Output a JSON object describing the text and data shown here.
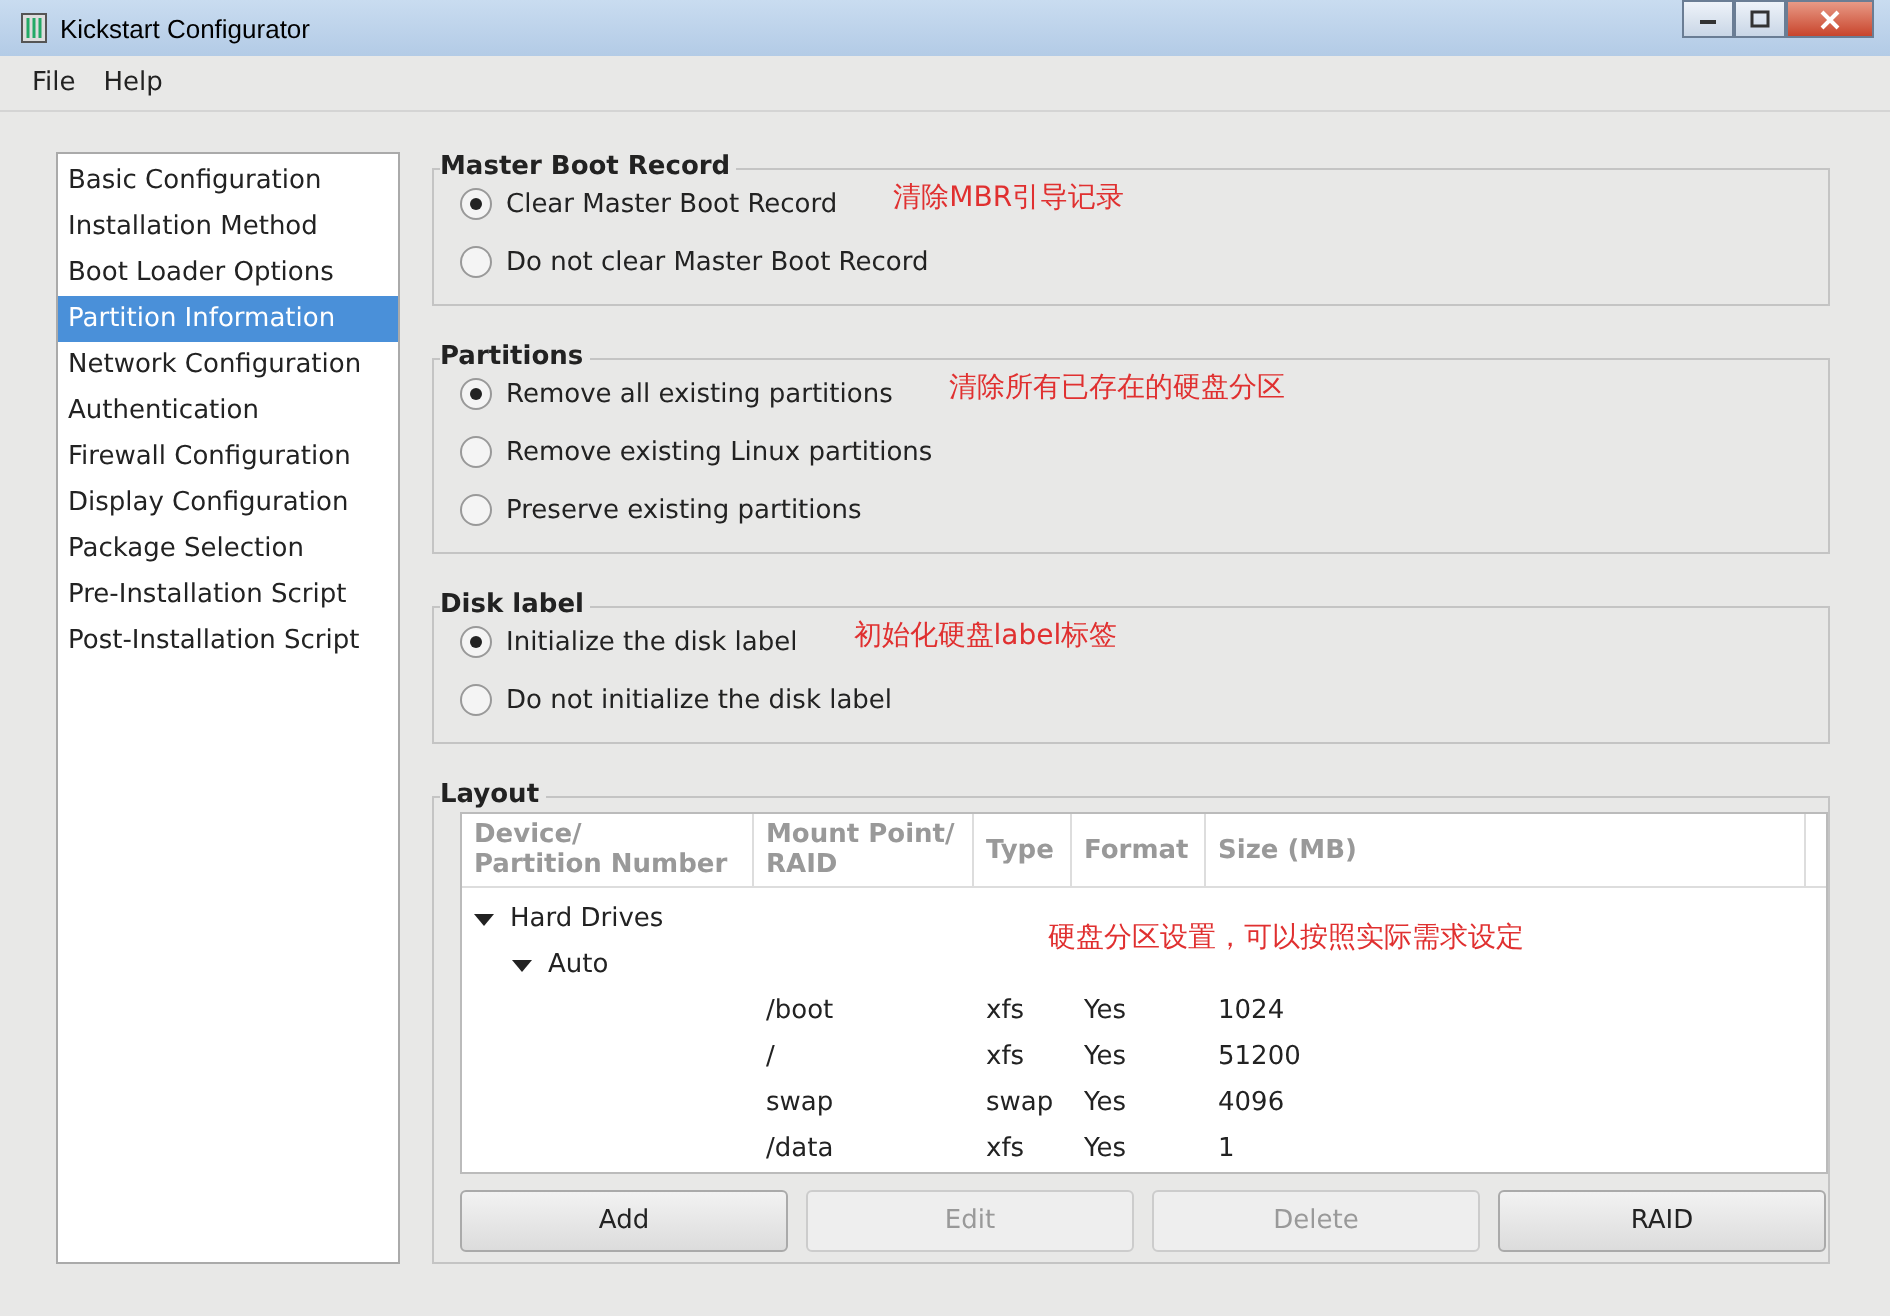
{
  "window": {
    "title": "Kickstart Configurator"
  },
  "menu": [
    {
      "label": "File"
    },
    {
      "label": "Help"
    }
  ],
  "sidebar": {
    "items": [
      {
        "label": "Basic Configuration",
        "selected": false
      },
      {
        "label": "Installation Method",
        "selected": false
      },
      {
        "label": "Boot Loader Options",
        "selected": false
      },
      {
        "label": "Partition Information",
        "selected": true
      },
      {
        "label": "Network Configuration",
        "selected": false
      },
      {
        "label": "Authentication",
        "selected": false
      },
      {
        "label": "Firewall Configuration",
        "selected": false
      },
      {
        "label": "Display Configuration",
        "selected": false
      },
      {
        "label": "Package Selection",
        "selected": false
      },
      {
        "label": "Pre-Installation Script",
        "selected": false
      },
      {
        "label": "Post-Installation Script",
        "selected": false
      }
    ]
  },
  "groups": [
    {
      "title": "Master Boot Record",
      "note": "清除MBR引导记录",
      "options": [
        {
          "label": "Clear Master Boot Record",
          "selected": true
        },
        {
          "label": "Do not clear Master Boot Record",
          "selected": false
        }
      ]
    },
    {
      "title": "Partitions",
      "note": "清除所有已存在的硬盘分区",
      "options": [
        {
          "label": "Remove all existing partitions",
          "selected": true
        },
        {
          "label": "Remove existing Linux partitions",
          "selected": false
        },
        {
          "label": "Preserve existing partitions",
          "selected": false
        }
      ]
    },
    {
      "title": "Disk label",
      "note": "初始化硬盘label标签",
      "options": [
        {
          "label": "Initialize the disk label",
          "selected": true
        },
        {
          "label": "Do not initialize the disk label",
          "selected": false
        }
      ]
    }
  ],
  "layout": {
    "title": "Layout",
    "note": "硬盘分区设置，可以按照实际需求设定",
    "columns": [
      "Device/\nPartition Number",
      "Mount Point/\nRAID",
      "Type",
      "Format",
      "Size (MB)"
    ],
    "tree": [
      {
        "label": "Hard Drives",
        "expanded": true,
        "children": [
          {
            "label": "Auto",
            "expanded": true,
            "children": [
              {
                "cells": [
                  "/boot",
                  "xfs",
                  "Yes",
                  "1024"
                ]
              },
              {
                "cells": [
                  "/",
                  "xfs",
                  "Yes",
                  "51200"
                ]
              },
              {
                "cells": [
                  "swap",
                  "swap",
                  "Yes",
                  "4096"
                ]
              },
              {
                "cells": [
                  "/data",
                  "xfs",
                  "Yes",
                  "1"
                ]
              }
            ]
          }
        ]
      }
    ],
    "buttons": [
      {
        "label": "Add",
        "disabled": false
      },
      {
        "label": "Edit",
        "disabled": true
      },
      {
        "label": "Delete",
        "disabled": true
      },
      {
        "label": "RAID",
        "disabled": false
      }
    ]
  }
}
